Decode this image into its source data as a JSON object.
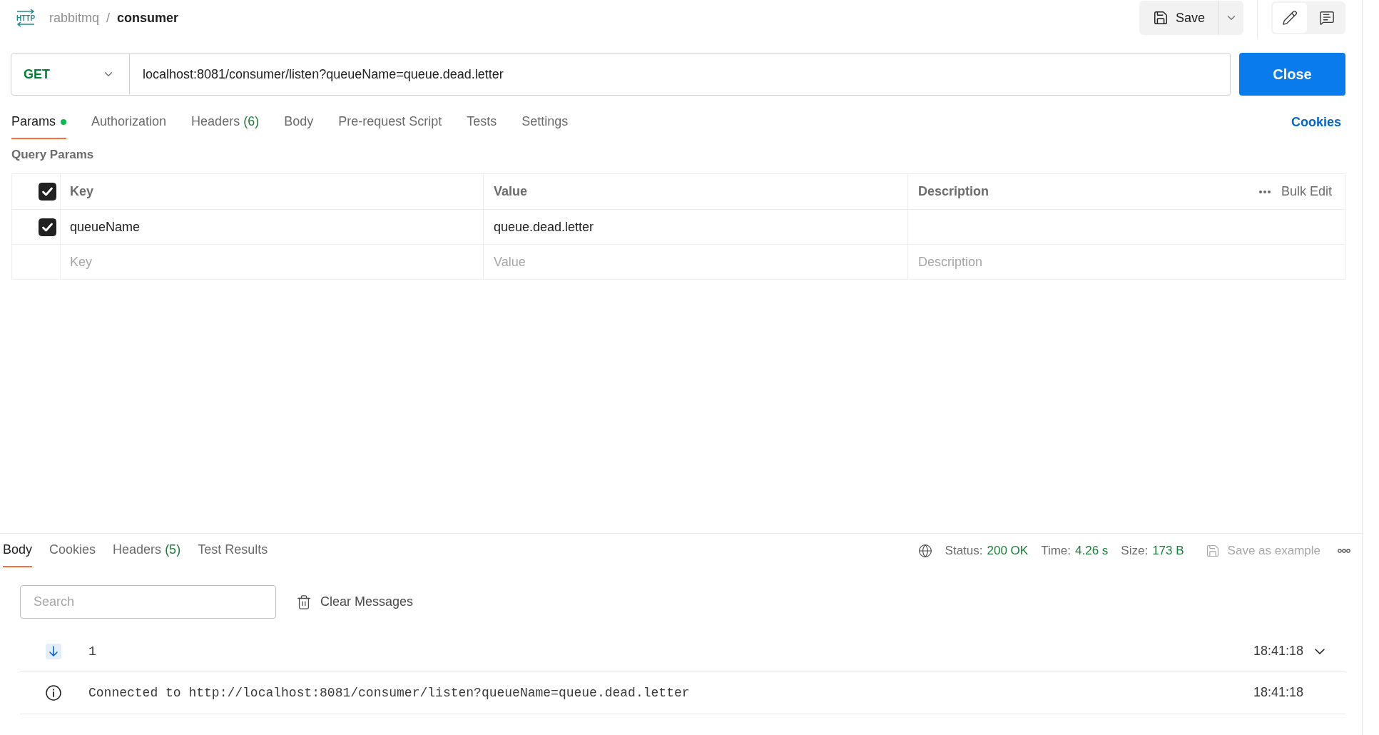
{
  "breadcrumb": {
    "icon_text": "HTTP",
    "collection": "rabbitmq",
    "separator": "/",
    "request": "consumer"
  },
  "toolbar": {
    "save_label": "Save",
    "modes": [
      {
        "kind": "edit",
        "selected": true
      },
      {
        "kind": "comments",
        "selected": false
      }
    ]
  },
  "request": {
    "method": "GET",
    "url": "localhost:8081/consumer/listen?queueName=queue.dead.letter",
    "action_label": "Close"
  },
  "request_tabs": [
    {
      "label": "Params",
      "dot": true,
      "selected": true
    },
    {
      "label": "Authorization",
      "dot": false,
      "selected": false
    },
    {
      "label": "Headers",
      "count": "(6)",
      "dot": false,
      "selected": false
    },
    {
      "label": "Body",
      "dot": false,
      "selected": false
    },
    {
      "label": "Pre-request Script",
      "dot": false,
      "selected": false
    },
    {
      "label": "Tests",
      "dot": false,
      "selected": false
    },
    {
      "label": "Settings",
      "dot": false,
      "selected": false
    }
  ],
  "cookies_link": "Cookies",
  "query_params": {
    "title": "Query Params",
    "all_checked": true,
    "columns": [
      "Key",
      "Value",
      "Description"
    ],
    "bulk_edit": "Bulk Edit",
    "rows": [
      {
        "checked": true,
        "key": "queueName",
        "value": "queue.dead.letter"
      }
    ],
    "placeholders": [
      "Key",
      "Value",
      "Description"
    ]
  },
  "response": {
    "tabs": [
      {
        "label": "Body",
        "selected": true
      },
      {
        "label": "Cookies",
        "selected": false
      },
      {
        "label": "Headers",
        "count": "(5)",
        "selected": false
      },
      {
        "label": "Test Results",
        "selected": false
      }
    ],
    "stats": [
      {
        "label": "Status:",
        "value": "200 OK"
      },
      {
        "label": "Time:",
        "value": "4.26 s"
      },
      {
        "label": "Size:",
        "value": "173 B"
      }
    ],
    "save_example": {
      "label": "Save as example",
      "disabled": true
    }
  },
  "messages": {
    "search_placeholder": "Search",
    "clear_label": "Clear Messages",
    "items": [
      {
        "kind": "received",
        "text": "1",
        "time": "18:41:18",
        "expanded": false
      },
      {
        "kind": "info",
        "text": "Connected to http://localhost:8081/consumer/listen?queueName=queue.dead.letter",
        "time": "18:41:18"
      }
    ]
  }
}
